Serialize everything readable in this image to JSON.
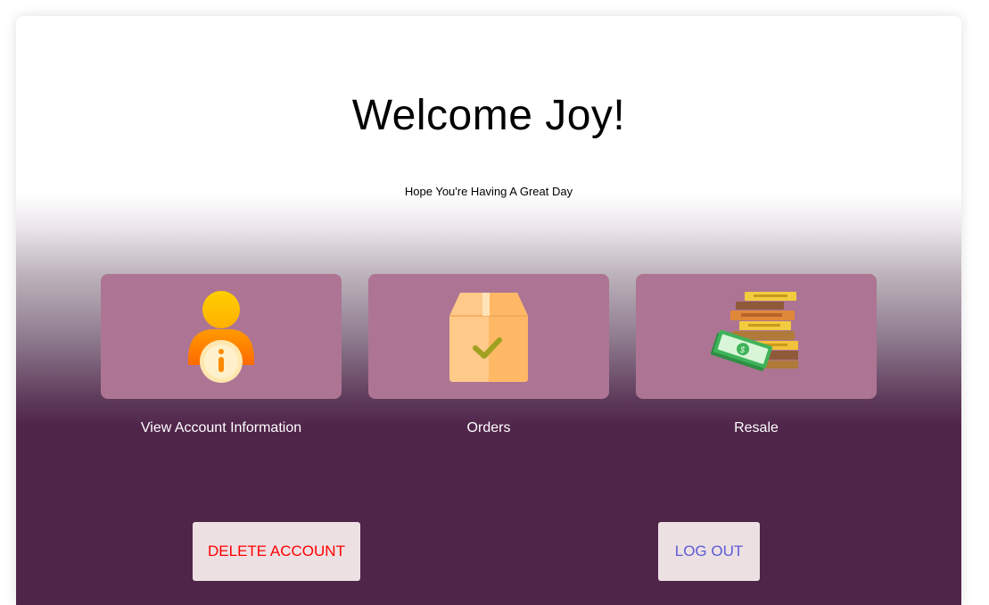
{
  "header": {
    "title": "Welcome Joy!",
    "subtitle": "Hope You're Having A Great Day"
  },
  "cards": [
    {
      "label": "View Account Information",
      "icon": "user-info-icon"
    },
    {
      "label": "Orders",
      "icon": "package-check-icon"
    },
    {
      "label": "Resale",
      "icon": "books-money-icon"
    }
  ],
  "actions": {
    "delete_label": "DELETE ACCOUNT",
    "logout_label": "LOG OUT"
  },
  "colors": {
    "card_bg": "#ad7593",
    "dark_bg": "#50254a",
    "delete_text": "#ff0000",
    "logout_text": "#5b5bd6",
    "button_bg": "#ede0e3"
  }
}
